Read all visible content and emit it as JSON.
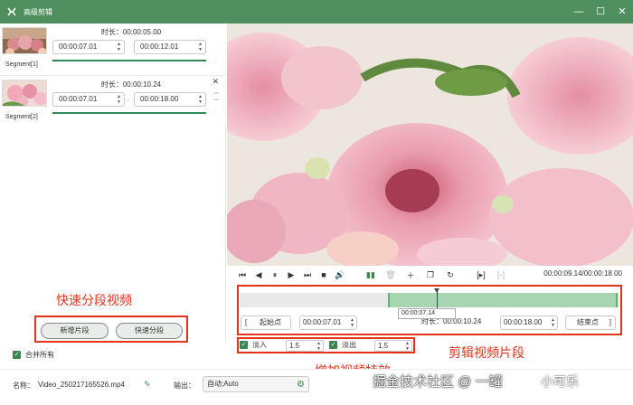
{
  "window": {
    "title": "高级剪辑"
  },
  "segments": [
    {
      "label": "Segment[1]",
      "duration": "时长：00:00:05.00",
      "start": "00:00:07.01",
      "end": "00:00:12.01"
    },
    {
      "label": "Segment[2]",
      "duration": "时长：00:00:10.24",
      "start": "00:00:07.01",
      "end": "00:00:18.00",
      "dash": "-"
    }
  ],
  "annotations": {
    "quick_split": "快速分段视频",
    "clip_segment": "剪辑视频片段",
    "add_effects": "增加视频特效"
  },
  "buttons": {
    "add_segment": "新增片段",
    "fast_split": "快速分段"
  },
  "merge_all": {
    "label": "合并所有",
    "checked": true
  },
  "player": {
    "time": "00:00:09.14/00:00:18.00"
  },
  "trim": {
    "start_label": "起始点",
    "start": "00:00:07.01",
    "duration_label": "时长：",
    "duration": "00:00:10.24",
    "end": "00:00:18.00",
    "end_label": "结束点",
    "tooltip": "00:00:07.14",
    "selection_start_fraction": 0.39,
    "playhead_fraction": 0.52
  },
  "fade": {
    "in_label": "淡入",
    "in_value": "1.5",
    "out_label": "淡出",
    "out_value": "1.5"
  },
  "bottom": {
    "name_label": "名称：",
    "name_value": "Video_250217165526.mp4",
    "output_label": "输出：",
    "output_value": "自动;Auto"
  },
  "watermark": {
    "text": "掘金技术社区 @ 一罐",
    "logo": "小可乐"
  },
  "colors": {
    "brand_green": "#4f8f5d",
    "annotation_red": "#e5331b",
    "selection_green": "#a9d6b2"
  }
}
